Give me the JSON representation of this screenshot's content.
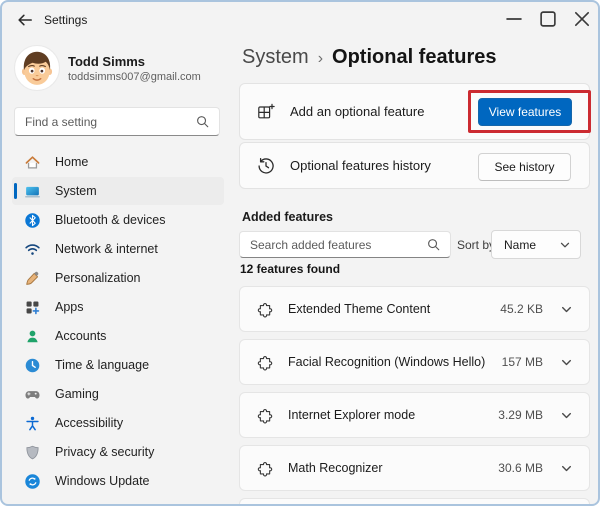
{
  "window": {
    "title": "Settings"
  },
  "user": {
    "name": "Todd Simms",
    "email": "toddsimms007@gmail.com"
  },
  "sidebar": {
    "search_placeholder": "Find a setting",
    "items": [
      {
        "label": "Home",
        "icon": "home-icon",
        "selected": false
      },
      {
        "label": "System",
        "icon": "system-icon",
        "selected": true
      },
      {
        "label": "Bluetooth & devices",
        "icon": "bluetooth-icon",
        "selected": false
      },
      {
        "label": "Network & internet",
        "icon": "network-icon",
        "selected": false
      },
      {
        "label": "Personalization",
        "icon": "personalization-icon",
        "selected": false
      },
      {
        "label": "Apps",
        "icon": "apps-icon",
        "selected": false
      },
      {
        "label": "Accounts",
        "icon": "accounts-icon",
        "selected": false
      },
      {
        "label": "Time & language",
        "icon": "time-language-icon",
        "selected": false
      },
      {
        "label": "Gaming",
        "icon": "gaming-icon",
        "selected": false
      },
      {
        "label": "Accessibility",
        "icon": "accessibility-icon",
        "selected": false
      },
      {
        "label": "Privacy & security",
        "icon": "privacy-icon",
        "selected": false
      },
      {
        "label": "Windows Update",
        "icon": "windows-update-icon",
        "selected": false
      }
    ]
  },
  "header": {
    "breadcrumb_parent": "System",
    "separator": "›",
    "title": "Optional features"
  },
  "cards": [
    {
      "icon": "add-feature-icon",
      "label": "Add an optional feature",
      "button_label": "View features",
      "style": "primary",
      "annotated": true
    },
    {
      "icon": "history-icon",
      "label": "Optional features history",
      "button_label": "See history",
      "style": "secondary",
      "annotated": false
    }
  ],
  "added_features": {
    "section_title": "Added features",
    "search_placeholder": "Search added features",
    "sort_label": "Sort by:",
    "sort_value": "Name",
    "count_text": "12 features found",
    "items": [
      {
        "icon": "puzzle-icon",
        "name": "Extended Theme Content",
        "size": "45.2 KB"
      },
      {
        "icon": "puzzle-icon",
        "name": "Facial Recognition (Windows Hello)",
        "size": "157 MB"
      },
      {
        "icon": "puzzle-icon",
        "name": "Internet Explorer mode",
        "size": "3.29 MB"
      },
      {
        "icon": "puzzle-icon",
        "name": "Math Recognizer",
        "size": "30.6 MB"
      }
    ]
  },
  "colors": {
    "accent": "#0067c0",
    "annotation_red": "#cc2b31",
    "window_border": "#aac4de"
  }
}
